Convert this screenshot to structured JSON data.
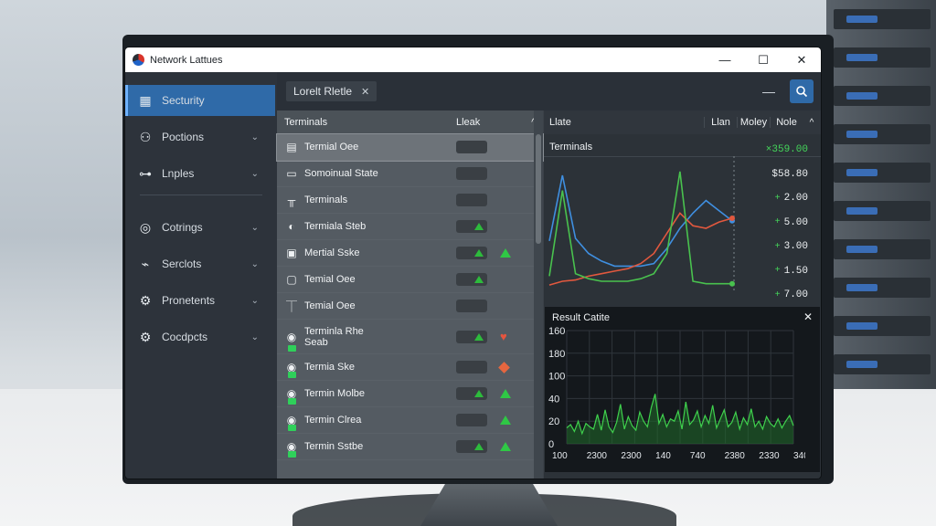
{
  "window": {
    "title": "Network Lattues"
  },
  "sidebar": {
    "items": [
      {
        "label": "Secturity",
        "icon": "dashboard-grid-icon",
        "active": true,
        "chevron": false
      },
      {
        "label": "Poctions",
        "icon": "user-icon",
        "active": false,
        "chevron": true
      },
      {
        "label": "Lnples",
        "icon": "nodes-icon",
        "active": false,
        "chevron": true
      },
      {
        "label": "Cotrings",
        "icon": "cpu-icon",
        "active": false,
        "chevron": true
      },
      {
        "label": "Serclots",
        "icon": "plug-icon",
        "active": false,
        "chevron": true
      },
      {
        "label": "Pronetents",
        "icon": "gear-icon",
        "active": false,
        "chevron": true
      },
      {
        "label": "Cocdpcts",
        "icon": "gear-alt-icon",
        "active": false,
        "chevron": true
      }
    ]
  },
  "tabbar": {
    "tab_label": "Lorelt Rletle",
    "close_glyph": "✕",
    "min_glyph": "—",
    "search_glyph": "⌕"
  },
  "list": {
    "header": {
      "col1": "Terminals",
      "col2": "Lleak",
      "sort": "^"
    },
    "rows": [
      {
        "name": "Termial Oee",
        "icon": "document-icon",
        "toggle": false,
        "status": ""
      },
      {
        "name": "Somoinual State",
        "icon": "terminal-icon",
        "toggle": false,
        "status": ""
      },
      {
        "name": "Terminals",
        "icon": "rack-icon",
        "toggle": false,
        "status": ""
      },
      {
        "name": "Termiala Steb",
        "icon": "disc-icon",
        "toggle": true,
        "status": ""
      },
      {
        "name": "Mertial Sske",
        "icon": "window-icon",
        "toggle": true,
        "status": "up"
      },
      {
        "name": "Temial Oee",
        "icon": "calendar-icon",
        "toggle": true,
        "status": ""
      },
      {
        "name": "Temial Oee",
        "icon": "plug-pins-icon",
        "toggle": false,
        "status": ""
      },
      {
        "name": "Terminla Rhe",
        "sub": "Seab",
        "icon": "lock-circle-icon",
        "toggle": true,
        "status": "heart"
      },
      {
        "name": "Termia Ske",
        "icon": "lock-circle-icon",
        "toggle": false,
        "status": "diamond"
      },
      {
        "name": "Termin Molbe",
        "icon": "lock-circle-icon",
        "toggle": true,
        "status": "up"
      },
      {
        "name": "Termin Clrea",
        "icon": "lock-circle-icon",
        "toggle": false,
        "status": "up"
      },
      {
        "name": "Termin Sstbe",
        "icon": "lock-circle-icon",
        "toggle": true,
        "status": "up"
      }
    ]
  },
  "detail": {
    "header": {
      "col1": "Llate",
      "col2": "Llan",
      "col3": "Moley",
      "col4": "Nole",
      "sort": "^"
    },
    "title": "Terminals",
    "values": [
      {
        "text": "×359.00",
        "arrow": "",
        "color": "#44d65a"
      },
      {
        "text": "$58.80",
        "arrow": "",
        "color": "#eef1f3"
      },
      {
        "text": "2.00",
        "arrow": "+",
        "color": "#eef1f3"
      },
      {
        "text": "5.00",
        "arrow": "+",
        "color": "#eef1f3"
      },
      {
        "text": "3.00",
        "arrow": "+",
        "color": "#eef1f3"
      },
      {
        "text": "1.50",
        "arrow": "+",
        "color": "#eef1f3"
      },
      {
        "text": "7.00",
        "arrow": "+",
        "color": "#eef1f3"
      }
    ],
    "line_chart": {
      "series": [
        {
          "color": "#3f8fe0",
          "values": [
            40,
            92,
            42,
            30,
            24,
            20,
            20,
            20,
            22,
            34,
            50,
            62,
            72,
            64,
            56
          ]
        },
        {
          "color": "#e2583e",
          "values": [
            5,
            8,
            9,
            12,
            14,
            16,
            18,
            22,
            30,
            46,
            62,
            52,
            50,
            55,
            58
          ]
        },
        {
          "color": "#49c24e",
          "values": [
            12,
            80,
            14,
            10,
            8,
            8,
            8,
            10,
            14,
            30,
            95,
            8,
            6,
            6,
            6
          ]
        }
      ]
    }
  },
  "mini_chart": {
    "title": "Result Catite",
    "close_glyph": "✕",
    "chart_data": {
      "type": "area",
      "title": "Result Catite",
      "y_ticks": [
        "160",
        "180",
        "100",
        "40",
        "20",
        "0"
      ],
      "x_ticks": [
        "100",
        "2300",
        "2300",
        "140",
        "740",
        "2380",
        "2330",
        "340"
      ],
      "ylim": [
        0,
        200
      ],
      "values": [
        28,
        34,
        22,
        40,
        18,
        36,
        30,
        26,
        52,
        24,
        60,
        30,
        20,
        38,
        70,
        26,
        48,
        32,
        24,
        56,
        40,
        30,
        64,
        88,
        36,
        52,
        30,
        44,
        40,
        58,
        26,
        74,
        34,
        42,
        58,
        30,
        50,
        36,
        68,
        28,
        44,
        60,
        30,
        38,
        56,
        26,
        46,
        34,
        62,
        30,
        40,
        26,
        48,
        36,
        30,
        44,
        28,
        40,
        50,
        32
      ]
    }
  },
  "colors": {
    "accent": "#2f6aa8",
    "green": "#2fc845",
    "red": "#e5553f"
  }
}
